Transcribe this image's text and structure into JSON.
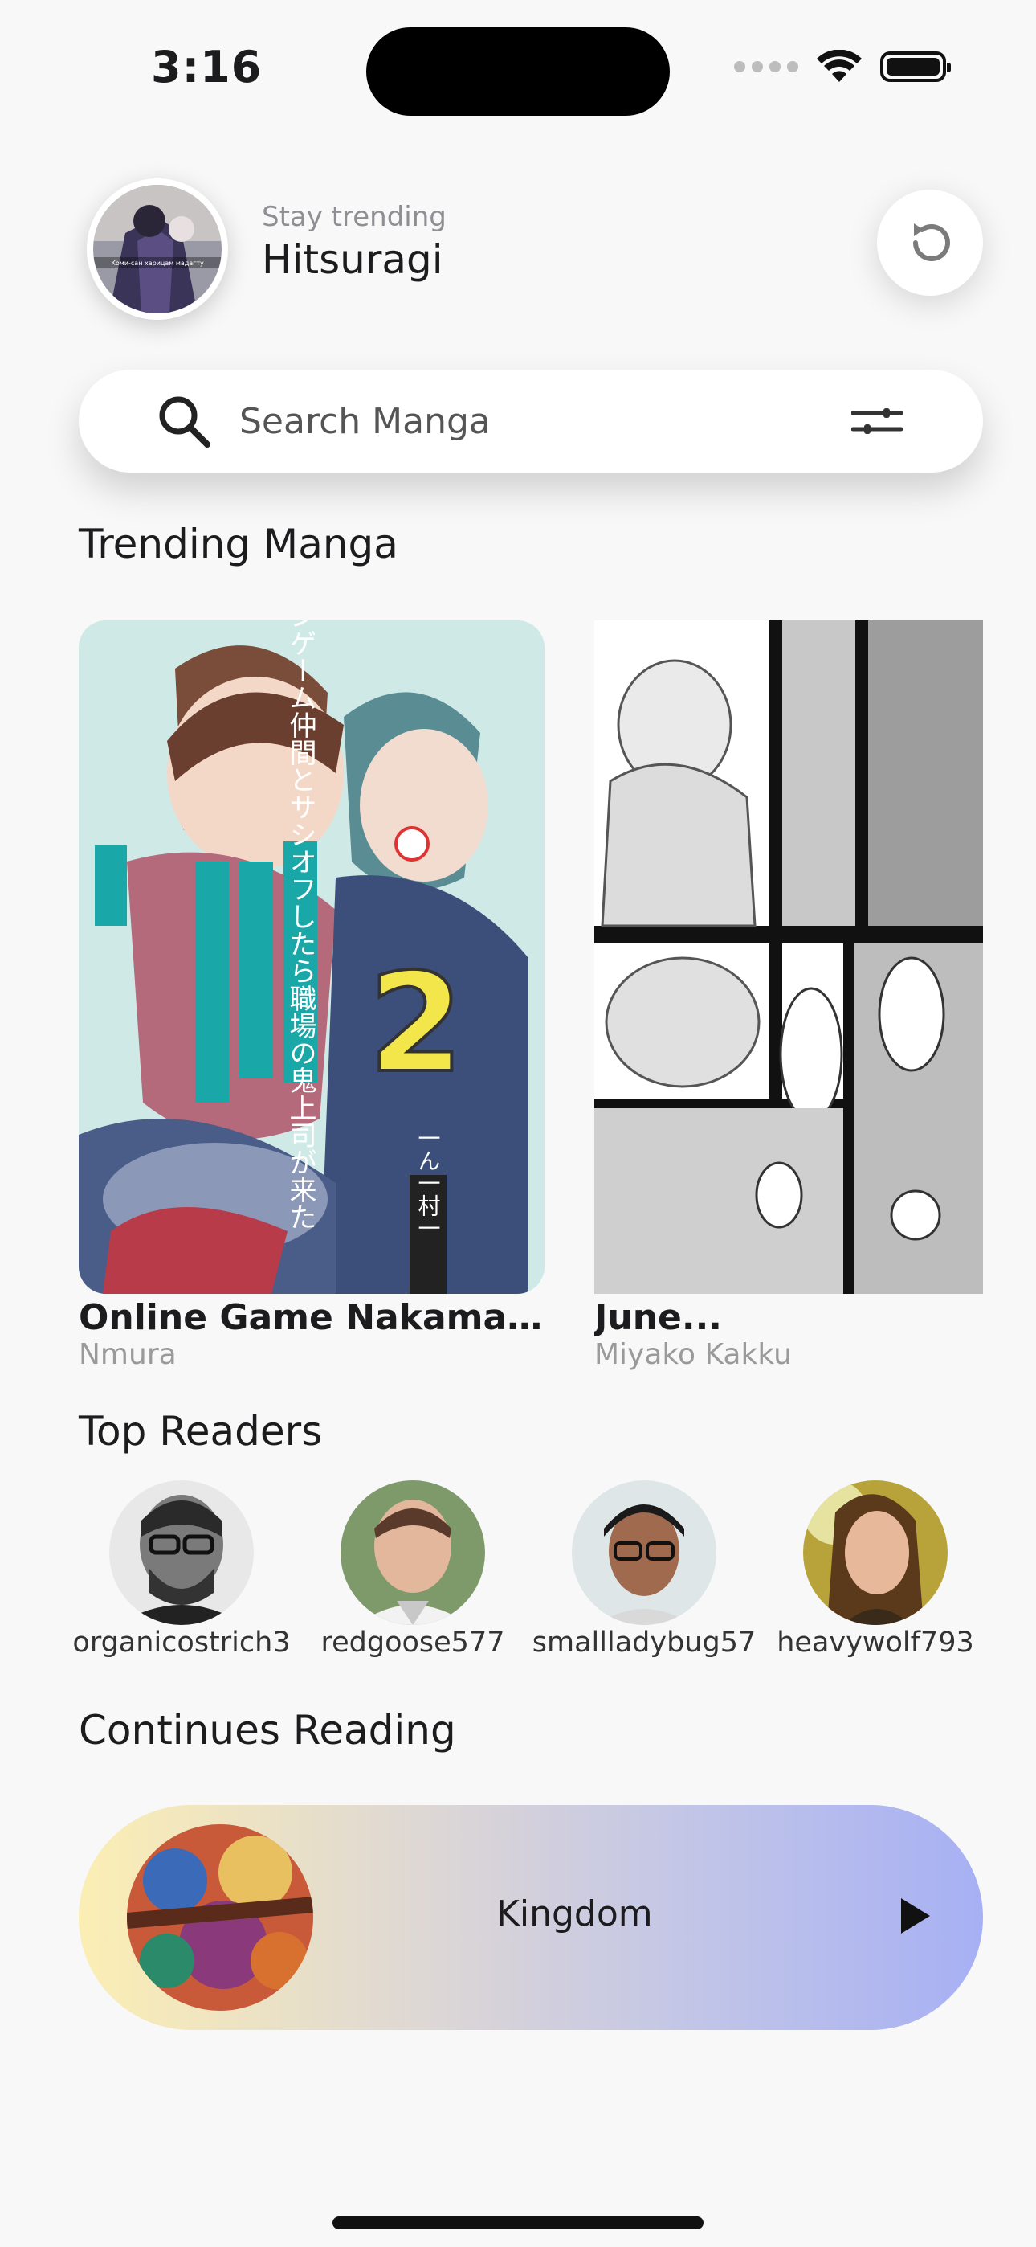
{
  "status_bar": {
    "time": "3:16"
  },
  "header": {
    "greeting": "Stay trending",
    "username": "Hitsuragi",
    "avatar_caption": "Коми-сан харицам мадагту"
  },
  "search": {
    "placeholder": "Search Manga"
  },
  "sections": {
    "trending": "Trending Manga",
    "top_readers": "Top Readers",
    "continue": "Continues Reading"
  },
  "trending": [
    {
      "title": "Online Game Nakama to...",
      "author": "Nmura",
      "cover_text": "オンラインゲーム仲間とサシオフしたら職場の鬼上司が来た",
      "volume": "2",
      "artist": "一ん一村一"
    },
    {
      "title": "June...",
      "author": "Miyako Kakku"
    }
  ],
  "readers": [
    {
      "name": "organicostrich3"
    },
    {
      "name": "redgoose577"
    },
    {
      "name": "smallladybug57"
    },
    {
      "name": "heavywolf793"
    }
  ],
  "continue_reading": {
    "title": "Kingdom"
  },
  "colors": {
    "background": "#f8f8f8",
    "gradient_start": "#fbeeb4",
    "gradient_end": "#a7b0f4",
    "cover_teal": "#1aa7a8"
  }
}
